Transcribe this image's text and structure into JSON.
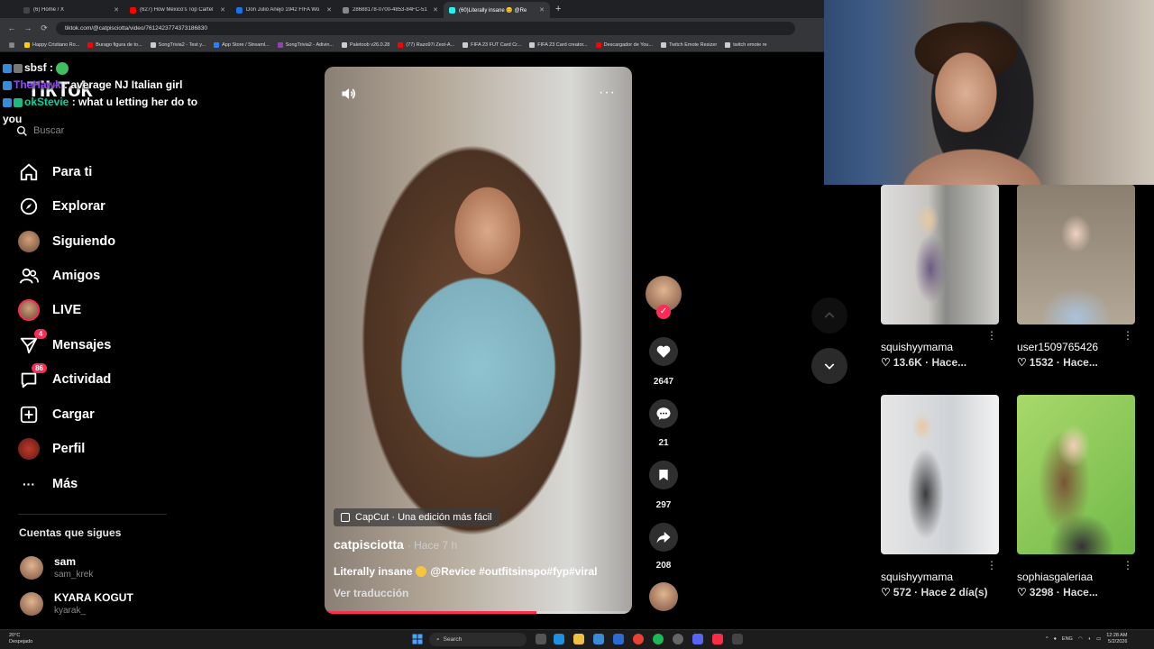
{
  "browser": {
    "tabs": [
      {
        "label": "(6) Home / X",
        "color": "#444444"
      },
      {
        "label": "(627) How Mexico's Top Cartel",
        "color": "#ff0000"
      },
      {
        "label": "Don Julio Anejo 1942 FIFA Wo",
        "color": "#1a73e8"
      },
      {
        "label": "28688178-0700-4853-84FC-51",
        "color": "#888888"
      },
      {
        "label": "(60)Literally insane 😊 @Re",
        "color": "#25f4ee"
      }
    ],
    "new_tab_symbol": "+",
    "url": "tiktok.com/@catpisciotta/video/7612423774373186830",
    "bookmarks": [
      "Happy Cristiano Ro...",
      "Burago figura de to...",
      "SongTrivia2 - Test y...",
      "App Store / Streaml...",
      "SongTrivia2 - Adivin...",
      "Paletoob v26.0.28",
      "(77) Razo97i Zest-A...",
      "FIFA 23 FUT Card Cr...",
      "FIFA 23 Card creator...",
      "Descargador de You...",
      "Twitch Emote Resizer",
      "twitch emote re"
    ]
  },
  "sidebar": {
    "logo": "TikTok",
    "search_placeholder": "Buscar",
    "nav": [
      {
        "label": "Para ti",
        "icon": "home-icon"
      },
      {
        "label": "Explorar",
        "icon": "compass-icon"
      },
      {
        "label": "Siguiendo",
        "icon": "avatar-icon"
      },
      {
        "label": "Amigos",
        "icon": "friends-icon"
      },
      {
        "label": "LIVE",
        "icon": "live-icon"
      },
      {
        "label": "Mensajes",
        "icon": "send-icon",
        "badge": "4"
      },
      {
        "label": "Actividad",
        "icon": "bell-icon",
        "badge": "86"
      },
      {
        "label": "Cargar",
        "icon": "plus-square-icon"
      },
      {
        "label": "Perfil",
        "icon": "profile-icon"
      },
      {
        "label": "Más",
        "icon": "more-icon"
      }
    ],
    "following_title": "Cuentas que sigues",
    "accounts": [
      {
        "name": "sam",
        "handle": "sam_krek"
      },
      {
        "name": "KYARA KOGUT",
        "handle": "kyarak_"
      }
    ]
  },
  "chat": [
    {
      "user": "sbsf",
      "sep": " : ",
      "message": ""
    },
    {
      "user": "TheHawk",
      "sep": " : ",
      "message": "average NJ Italian girl"
    },
    {
      "user": "okStevie",
      "sep": " : ",
      "message": "what u letting her do to you"
    }
  ],
  "video": {
    "capcut_label": "CapCut · Una edición más fácil",
    "author": "catpisciotta",
    "ago": "· Hace 7 h",
    "caption_text": "Literally insane",
    "caption_tags": "@Revice #outfitsinspo#fyp#viral",
    "translate": "Ver traducción",
    "progress": 0.69
  },
  "actions": {
    "likes": "2647",
    "comments": "21",
    "saves": "297",
    "shares": "208"
  },
  "recommendations": [
    {
      "name": "squishyymama",
      "meta": "13.6K · Hace..."
    },
    {
      "name": "user1509765426",
      "meta": "1532 · Hace..."
    },
    {
      "name": "squishyymama",
      "meta": "572 · Hace 2 día(s)"
    },
    {
      "name": "sophiasgaleriaa",
      "meta": "3298 · Hace..."
    }
  ],
  "taskbar": {
    "weather_temp": "20°C",
    "weather_desc": "Despejado",
    "search": "Search",
    "lang": "ENG",
    "time": "12:28 AM",
    "date": "5/2/2026"
  },
  "colors": {
    "accent": "#fe2c55",
    "background": "#000000"
  }
}
